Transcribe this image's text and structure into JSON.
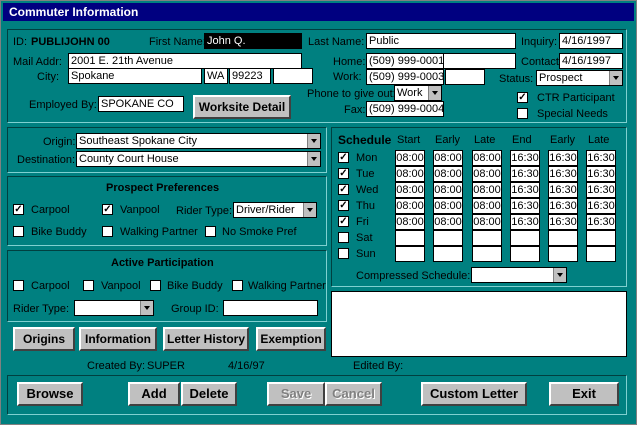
{
  "window": {
    "title": "Commuter Information"
  },
  "header": {
    "id_label": "ID:",
    "id_value": "PUBLIJOHN 00",
    "first_name_label": "First Name:",
    "first_name": "John Q.",
    "last_name_label": "Last Name:",
    "last_name": "Public",
    "inquiry_label": "Inquiry:",
    "inquiry": "4/16/1997",
    "mail_addr_label": "Mail Addr:",
    "mail_addr": "2001 E. 21th Avenue",
    "contact_label": "Contact:",
    "contact": "4/16/1997",
    "city_label": "City:",
    "city": "Spokane",
    "state": "WA",
    "zip": "99223",
    "zip_ext": "",
    "home_label": "Home:",
    "home_phone": "(509) 999-0001",
    "work_label": "Work:",
    "work_phone": "(509) 999-0003",
    "work_ext": "",
    "status_label": "Status:",
    "status": "Prospect",
    "employed_by_label": "Employed By:",
    "employed_by": "SPOKANE CO",
    "worksite_button": "Worksite Detail",
    "phone_give_label_1": "Phone to give out:",
    "phone_give": "Work",
    "fax_label": "Fax:",
    "fax": "(509) 999-0004",
    "ctr_label": "CTR Participant",
    "ctr_checked": true,
    "special_label": "Special Needs",
    "special_checked": false
  },
  "route": {
    "origin_label": "Origin:",
    "origin": "Southeast Spokane City",
    "destination_label": "Destination:",
    "destination": "County Court House"
  },
  "prospect": {
    "title": "Prospect Preferences",
    "carpool": "Carpool",
    "carpool_checked": true,
    "vanpool": "Vanpool",
    "vanpool_checked": true,
    "rider_type_label": "Rider Type:",
    "rider_type": "Driver/Rider",
    "bike_buddy": "Bike Buddy",
    "bike_checked": false,
    "walking_partner": "Walking Partner",
    "walking_checked": false,
    "no_smoke": "No Smoke Pref",
    "no_smoke_checked": false
  },
  "active": {
    "title": "Active Participation",
    "carpool": "Carpool",
    "vanpool": "Vanpool",
    "bike_buddy": "Bike Buddy",
    "walking_partner": "Walking Partner",
    "rider_type_label": "Rider Type:",
    "rider_type": "",
    "group_id_label": "Group ID:",
    "group_id": ""
  },
  "schedule": {
    "title": "Schedule",
    "columns": [
      "Start",
      "Early",
      "Late",
      "End",
      "Early",
      "Late"
    ],
    "days": [
      {
        "name": "Mon",
        "checked": true,
        "times": [
          "08:00",
          "08:00",
          "08:00",
          "16:30",
          "16:30",
          "16:30"
        ]
      },
      {
        "name": "Tue",
        "checked": true,
        "times": [
          "08:00",
          "08:00",
          "08:00",
          "16:30",
          "16:30",
          "16:30"
        ]
      },
      {
        "name": "Wed",
        "checked": true,
        "times": [
          "08:00",
          "08:00",
          "08:00",
          "16:30",
          "16:30",
          "16:30"
        ]
      },
      {
        "name": "Thu",
        "checked": true,
        "times": [
          "08:00",
          "08:00",
          "08:00",
          "16:30",
          "16:30",
          "16:30"
        ]
      },
      {
        "name": "Fri",
        "checked": true,
        "times": [
          "08:00",
          "08:00",
          "08:00",
          "16:30",
          "16:30",
          "16:30"
        ]
      },
      {
        "name": "Sat",
        "checked": false,
        "times": [
          "",
          "",
          "",
          "",
          "",
          ""
        ]
      },
      {
        "name": "Sun",
        "checked": false,
        "times": [
          "",
          "",
          "",
          "",
          "",
          ""
        ]
      }
    ],
    "compressed_label": "Compressed Schedule:",
    "compressed": ""
  },
  "tabs": {
    "origins": "Origins",
    "information": "Information",
    "letter_history": "Letter History",
    "exemption": "Exemption"
  },
  "footer": {
    "created_by_label": "Created By:",
    "created_by": "SUPER",
    "created_date": "4/16/97",
    "edited_by_label": "Edited By:",
    "edited_by": ""
  },
  "actions": {
    "browse": "Browse",
    "add": "Add",
    "delete": "Delete",
    "save": "Save",
    "cancel": "Cancel",
    "custom_letter": "Custom Letter",
    "exit": "Exit"
  },
  "colors": {
    "window_bg": "#008080",
    "title_bg": "#000080"
  }
}
